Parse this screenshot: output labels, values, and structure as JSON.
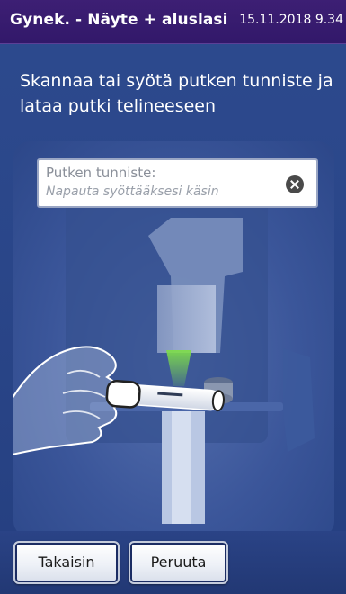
{
  "header": {
    "title": "Gynek. - Näyte + aluslasi",
    "datetime": "15.11.2018 9.34"
  },
  "instruction": "Skannaa tai syötä putken tunniste ja lataa putki telineeseen",
  "tube_id_field": {
    "label": "Putken tunniste:",
    "placeholder": "Napauta syöttääksesi käsin",
    "clear_icon": "close-circle-icon"
  },
  "footer": {
    "back_label": "Takaisin",
    "cancel_label": "Peruuta"
  },
  "colors": {
    "header_bg": "#3d1f74",
    "screen_bg": "#2d4a8e",
    "scanner_beam": "#7ddc4a"
  }
}
